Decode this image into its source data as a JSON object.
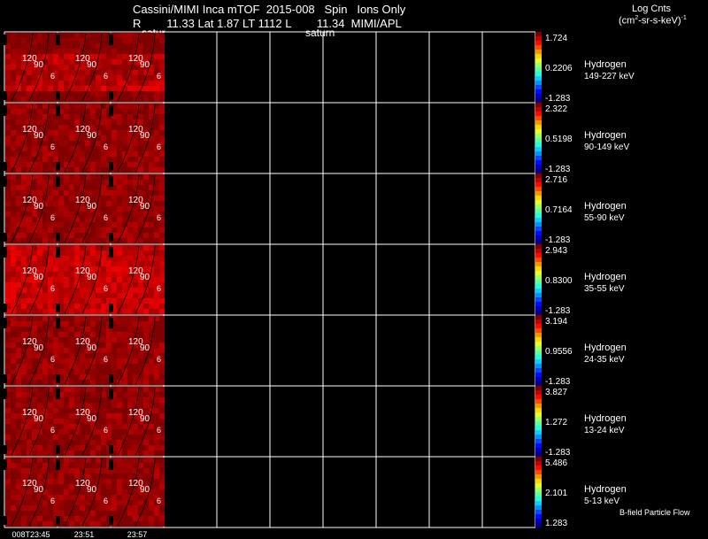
{
  "header": {
    "title": "Cassini/MIMI Inca mTOF  2015-008   Spin   Ions Only",
    "info": "R        11.33 Lat 1.87 LT 1112 L        11.34  MIMI/APL",
    "label_left": "satur",
    "label_right": "saturn"
  },
  "units": {
    "title": "Log Cnts",
    "expr_main": "(cm",
    "expr_sup1": "2",
    "expr_mid": "-sr-s-keV)",
    "expr_sup2": "-1"
  },
  "contour_labels": [
    "120",
    "90",
    "6"
  ],
  "time_labels": [
    "008T23:45",
    "23:51",
    "23:57"
  ],
  "footer_note": "B-field Particle Flow",
  "colors": {
    "background": "#000000",
    "grid": "#ffffff",
    "contour": "#000000"
  },
  "rows": [
    {
      "species": "Hydrogen",
      "energy": "149-227 keV",
      "cb_max": "1.724",
      "cb_mid": "0.2206",
      "cb_min": "-1.283",
      "intensity": 0.55
    },
    {
      "species": "Hydrogen",
      "energy": "90-149 keV",
      "cb_max": "2.322",
      "cb_mid": "0.5198",
      "cb_min": "-1.283",
      "intensity": 0.8
    },
    {
      "species": "Hydrogen",
      "energy": "55-90 keV",
      "cb_max": "2.716",
      "cb_mid": "0.7164",
      "cb_min": "-1.283",
      "intensity": 0.8
    },
    {
      "species": "Hydrogen",
      "energy": "35-55 keV",
      "cb_max": "2.943",
      "cb_mid": "0.8300",
      "cb_min": "-1.283",
      "intensity": 0.75
    },
    {
      "species": "Hydrogen",
      "energy": "24-35 keV",
      "cb_max": "3.194",
      "cb_mid": "0.9556",
      "cb_min": "-1.283",
      "intensity": 0.8
    },
    {
      "species": "Hydrogen",
      "energy": "13-24 keV",
      "cb_max": "3.827",
      "cb_mid": "1.272",
      "cb_min": "-1.283",
      "intensity": 0.8
    },
    {
      "species": "Hydrogen",
      "energy": "5-13 keV",
      "cb_max": "5.486",
      "cb_mid": "2.101",
      "cb_min": "1.283",
      "intensity": 0.8
    }
  ]
}
